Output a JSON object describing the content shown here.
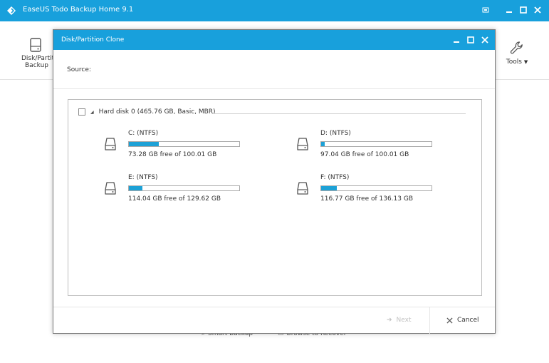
{
  "app": {
    "title": "EaseUS Todo Backup Home 9.1",
    "toolbar": {
      "disk_backup_label_line1": "Disk/Partit",
      "disk_backup_label_line2": "Backup",
      "tools_label": "Tools"
    },
    "bottom_links": {
      "smart_backup": "Smart Backup",
      "browse_to_recover": "Browse to Recover"
    }
  },
  "dialog": {
    "title": "Disk/Partition Clone",
    "source_label": "Source:",
    "disk": {
      "title": "Hard disk 0 (465.76 GB, Basic, MBR)",
      "checked": false,
      "expanded": true
    },
    "partitions": [
      {
        "name": "C: (NTFS)",
        "free_text": "73.28 GB free of 100.01 GB",
        "used_fraction": 0.27
      },
      {
        "name": "D: (NTFS)",
        "free_text": "97.04 GB free of 100.01 GB",
        "used_fraction": 0.03
      },
      {
        "name": "E: (NTFS)",
        "free_text": "114.04 GB free of 129.62 GB",
        "used_fraction": 0.12
      },
      {
        "name": "F: (NTFS)",
        "free_text": "116.77 GB free of 136.13 GB",
        "used_fraction": 0.14
      }
    ],
    "buttons": {
      "next": "Next",
      "cancel": "Cancel"
    }
  },
  "colors": {
    "accent": "#18a0dc",
    "bar_fill": "#1da1d6"
  }
}
